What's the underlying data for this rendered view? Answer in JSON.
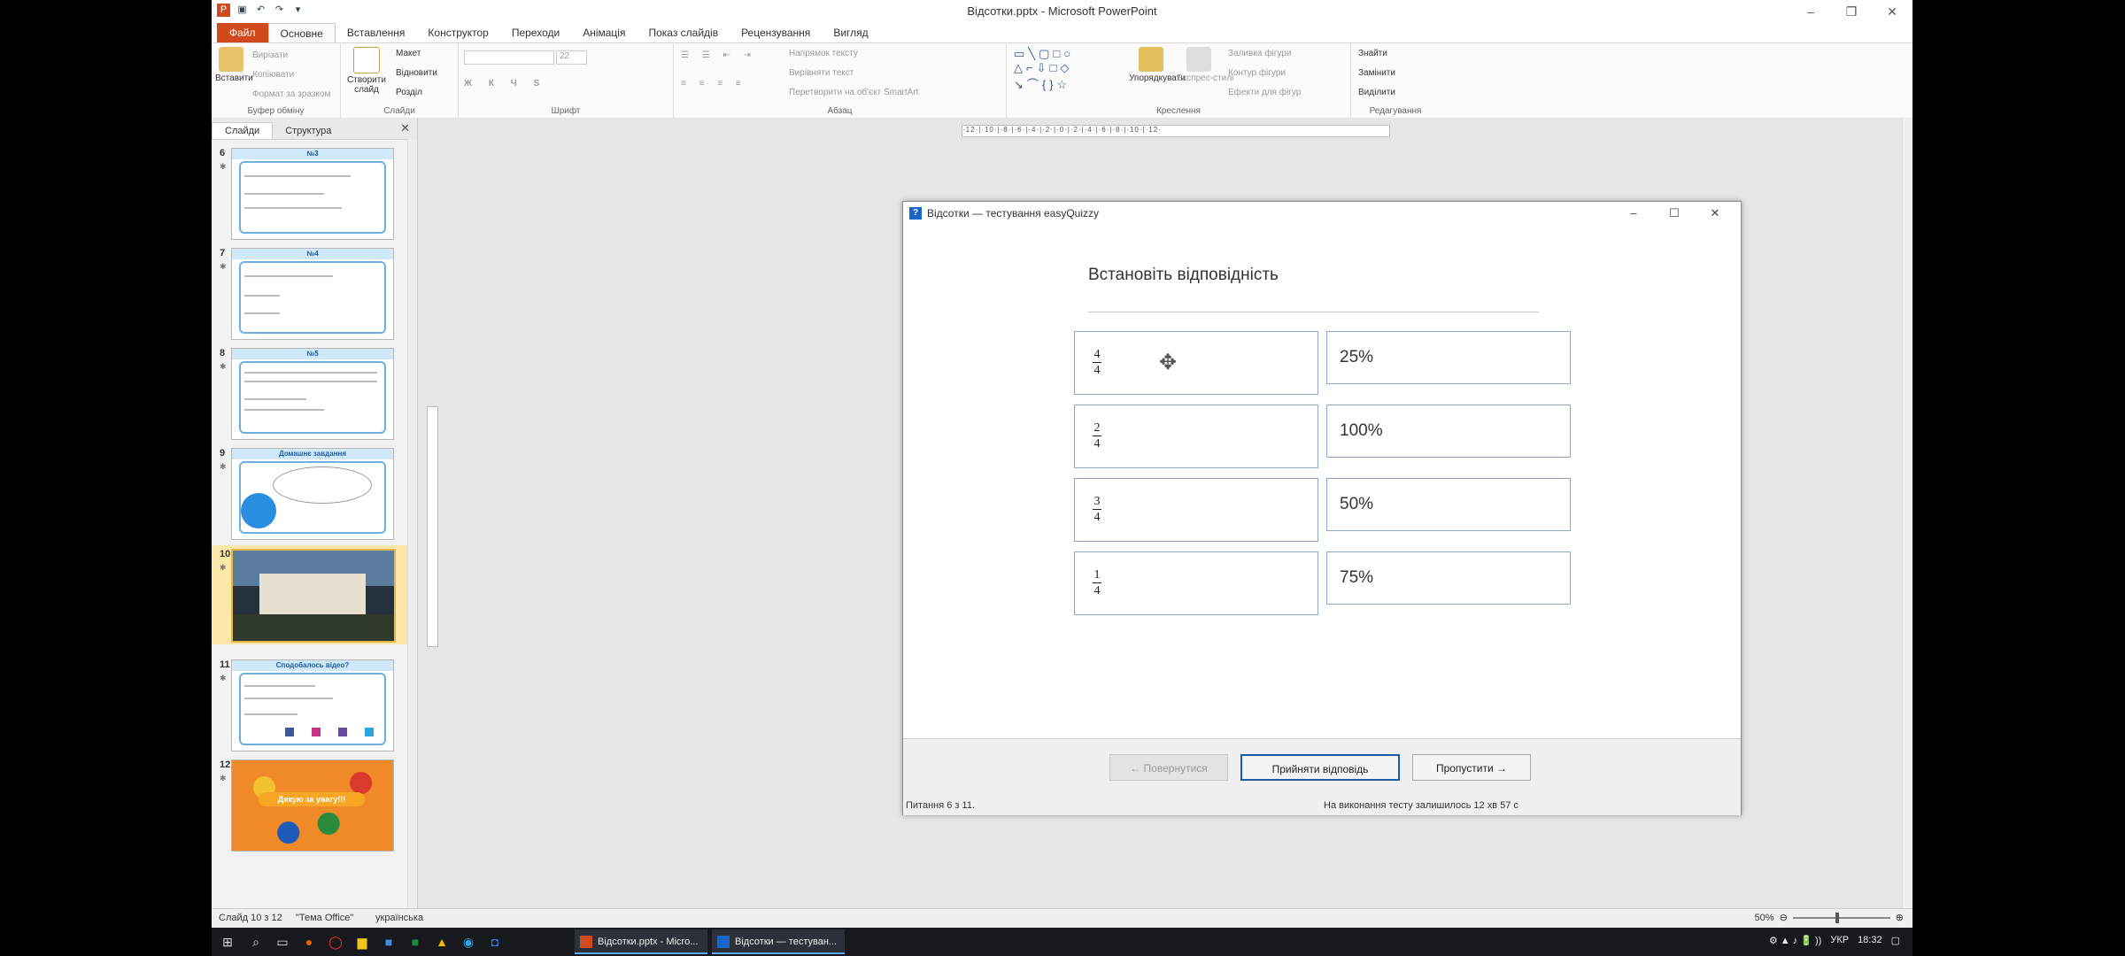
{
  "window": {
    "title": "Відсотки.pptx - Microsoft PowerPoint"
  },
  "ribbon": {
    "tabs": [
      "Файл",
      "Основне",
      "Вставлення",
      "Конструктор",
      "Переходи",
      "Анімація",
      "Показ слайдів",
      "Рецензування",
      "Вигляд"
    ],
    "active_tab": "Основне",
    "groups": {
      "clipboard": {
        "name": "Буфер обміну",
        "paste": "Вставити",
        "cut": "Вирізати",
        "copy": "Копіювати",
        "format": "Формат за зразком"
      },
      "slides": {
        "name": "Слайди",
        "new_slide": "Створити слайд",
        "layout": "Макет",
        "reset": "Відновити",
        "section": "Розділ"
      },
      "font": {
        "name": "Шрифт",
        "size": "22"
      },
      "paragraph": {
        "name": "Абзац",
        "text_direction": "Напрямок тексту",
        "align_text": "Вирівняти текст",
        "smartart": "Перетворити на об'єкт SmartArt"
      },
      "drawing": {
        "name": "Креслення",
        "arrange": "Упорядкувати",
        "quick_styles": "Експрес-стилі",
        "fill": "Заливка фігури",
        "outline": "Контур фігури",
        "effects": "Ефекти для фігур"
      },
      "editing": {
        "name": "Редагування",
        "find": "Знайти",
        "replace": "Замінити",
        "select": "Виділити"
      }
    }
  },
  "slide_panel": {
    "tabs": [
      "Слайди",
      "Структура"
    ],
    "slides": [
      {
        "num": "6",
        "title": "№3"
      },
      {
        "num": "7",
        "title": "№4"
      },
      {
        "num": "8",
        "title": "№5"
      },
      {
        "num": "9",
        "title": "Домашнє завдання"
      },
      {
        "num": "10",
        "title": ""
      },
      {
        "num": "11",
        "title": "Сподобалось відео?"
      },
      {
        "num": "12",
        "title": "Дякую за увагу!!!"
      }
    ],
    "selected": "10"
  },
  "dialog": {
    "title": "Відсотки — тестування easyQuizzy",
    "question": "Встановіть відповідність",
    "left_items": [
      {
        "num": "4",
        "den": "4"
      },
      {
        "num": "2",
        "den": "4"
      },
      {
        "num": "3",
        "den": "4"
      },
      {
        "num": "1",
        "den": "4"
      }
    ],
    "right_items": [
      "25%",
      "100%",
      "50%",
      "75%"
    ],
    "buttons": {
      "back": "← Повернутися",
      "accept": "Прийняти відповідь",
      "skip": "Пропустити →"
    },
    "status_left": "Питання 6 з 11.",
    "status_right": "На виконання тесту залишилось 12 хв 57 с"
  },
  "statusbar": {
    "slide_info": "Слайд 10 з 12",
    "theme": "\"Тема Office\"",
    "language": "українська",
    "zoom": "50%"
  },
  "taskbar": {
    "tasks": [
      "Відсотки.pptx - Micro...",
      "Відсотки — тестуван..."
    ],
    "language": "УКР",
    "time": "18:32"
  },
  "colors": {
    "file_tab": "#d04a1e",
    "accent_blue": "#1d5aa8",
    "selected_slide": "#fbe7a8"
  }
}
